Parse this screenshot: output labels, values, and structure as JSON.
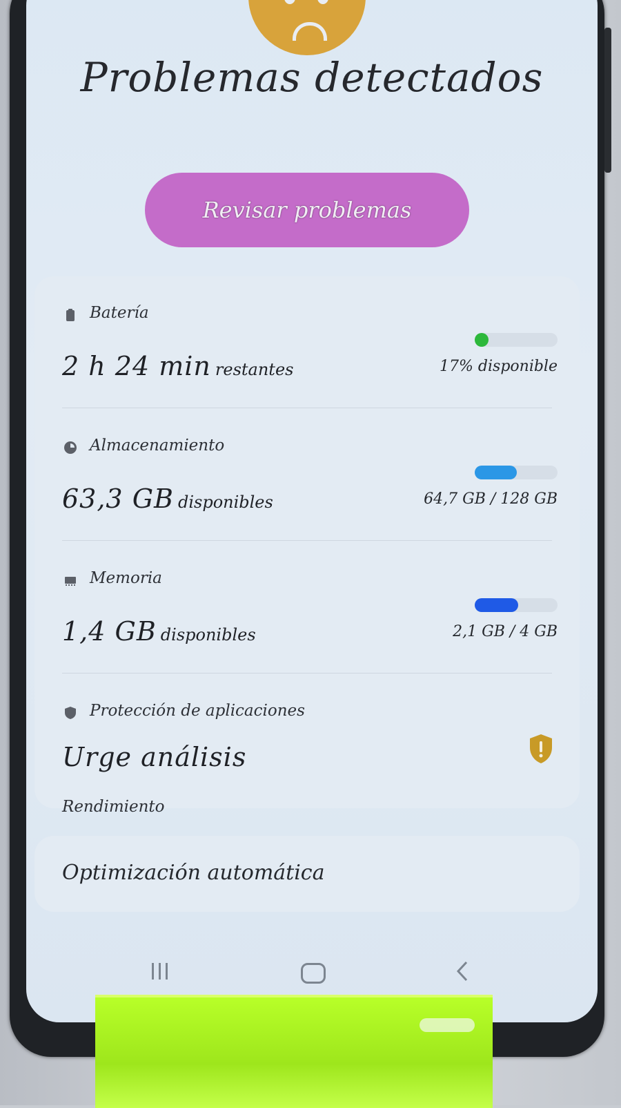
{
  "header": {
    "title": "Problemas detectados",
    "review_button": "Revisar problemas"
  },
  "battery": {
    "label": "Batería",
    "value": "2 h 24 min",
    "suffix": "restantes",
    "right_text": "17% disponible",
    "level_fraction": 0.17,
    "color": "#2db83b",
    "icon": "battery-icon"
  },
  "storage": {
    "label": "Almacenamiento",
    "value": "63,3 GB",
    "suffix": "disponibles",
    "right_text": "64,7 GB / 128 GB",
    "used_fraction": 0.505,
    "color": "#2b97e6",
    "icon": "storage-pie-icon"
  },
  "memory": {
    "label": "Memoria",
    "value": "1,4 GB",
    "suffix": "disponibles",
    "right_text": "2,1 GB / 4 GB",
    "used_fraction": 0.525,
    "color": "#1f5ae6",
    "icon": "memory-chip-icon"
  },
  "protection": {
    "label": "Protección de aplicaciones",
    "value": "Urge análisis",
    "icon": "shield-icon",
    "badge_icon": "shield-warning-icon",
    "badge_color": "#c89a26"
  },
  "performance": {
    "section_title": "Rendimiento",
    "item_label": "Optimización automática"
  },
  "navbar": {
    "recent_icon": "recent-apps-icon",
    "home_icon": "home-icon",
    "back_icon": "back-icon"
  }
}
